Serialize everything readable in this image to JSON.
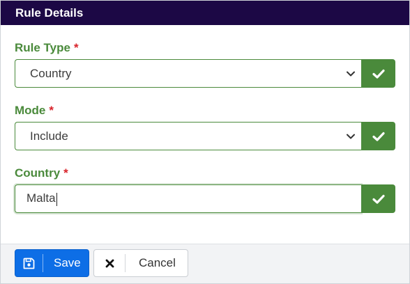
{
  "dialog": {
    "title": "Rule Details"
  },
  "fields": [
    {
      "label": "Rule Type",
      "required_mark": "*",
      "value": "Country",
      "kind": "select",
      "icon": "check-icon"
    },
    {
      "label": "Mode",
      "required_mark": "*",
      "value": "Include",
      "kind": "select",
      "icon": "check-icon"
    },
    {
      "label": "Country",
      "required_mark": "*",
      "value": "Malta",
      "kind": "text",
      "icon": "check-icon"
    }
  ],
  "footer": {
    "save_label": "Save",
    "save_icon": "floppy-disk-icon",
    "cancel_label": "Cancel",
    "cancel_icon": "x-mark-icon"
  },
  "colors": {
    "header_bg": "#1c0845",
    "label": "#4a8a3b",
    "required": "#d8232a",
    "addon": "#4a8a3b",
    "save_button": "#0d6ee6"
  }
}
